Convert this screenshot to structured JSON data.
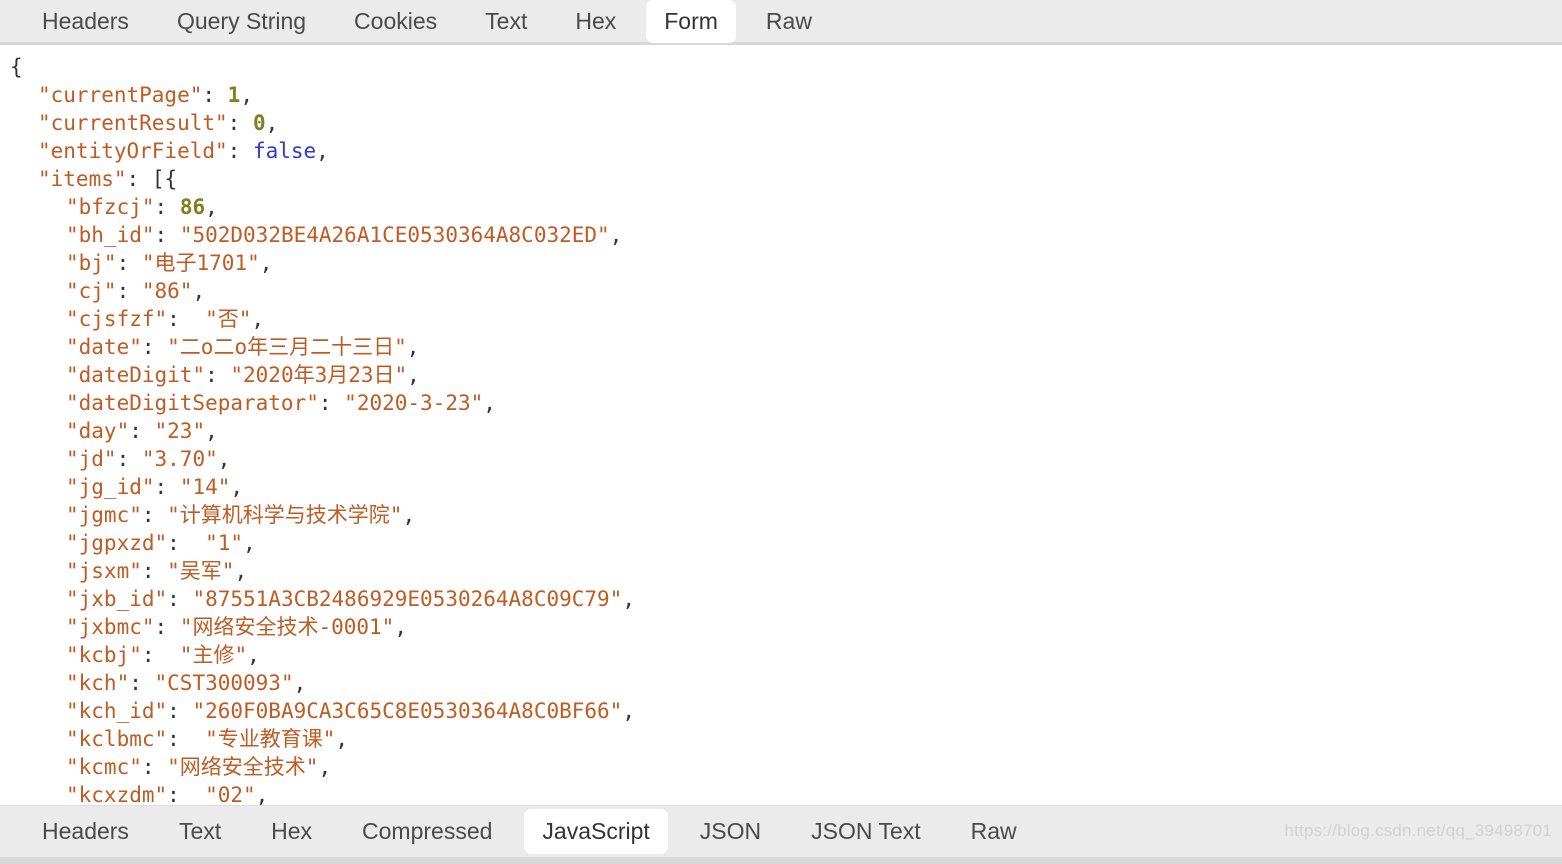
{
  "top_tabs": [
    {
      "label": "Headers",
      "active": false
    },
    {
      "label": "Query String",
      "active": false
    },
    {
      "label": "Cookies",
      "active": false
    },
    {
      "label": "Text",
      "active": false
    },
    {
      "label": "Hex",
      "active": false
    },
    {
      "label": "Form",
      "active": true
    },
    {
      "label": "Raw",
      "active": false
    }
  ],
  "bottom_tabs": [
    {
      "label": "Headers",
      "active": false
    },
    {
      "label": "Text",
      "active": false
    },
    {
      "label": "Hex",
      "active": false
    },
    {
      "label": "Compressed",
      "active": false
    },
    {
      "label": "JavaScript",
      "active": true
    },
    {
      "label": "JSON",
      "active": false
    },
    {
      "label": "JSON Text",
      "active": false
    },
    {
      "label": "Raw",
      "active": false
    }
  ],
  "watermark": "https://blog.csdn.net/qq_39498701",
  "colors": {
    "string": "#bf5b23",
    "key": "#bf5b23",
    "number": "#7f8021",
    "boolean": "#3535d8",
    "punctuation": "#333333",
    "tabbar_bg": "#ebebeb",
    "active_tab_bg": "#ffffff",
    "body_bg": "#ffffff"
  },
  "json_body": {
    "open_brace": "{",
    "lines": [
      {
        "indent": 2,
        "key": "currentPage",
        "value": "1",
        "type": "number",
        "comma": true
      },
      {
        "indent": 2,
        "key": "currentResult",
        "value": "0",
        "type": "number",
        "comma": true
      },
      {
        "indent": 2,
        "key": "entityOrField",
        "value": "false",
        "type": "boolean",
        "comma": true
      },
      {
        "indent": 2,
        "key": "items",
        "value": "[{",
        "type": "raw",
        "comma": false
      },
      {
        "indent": 3,
        "key": "bfzcj",
        "value": "86",
        "type": "number",
        "comma": true
      },
      {
        "indent": 3,
        "key": "bh_id",
        "value": "502D032BE4A26A1CE0530364A8C032ED",
        "type": "string",
        "comma": true
      },
      {
        "indent": 3,
        "key": "bj",
        "value": "电子1701",
        "type": "string",
        "comma": true
      },
      {
        "indent": 3,
        "key": "cj",
        "value": "86",
        "type": "string",
        "comma": true
      },
      {
        "indent": 3,
        "key": "cjsfzf",
        "value": "否",
        "type": "string",
        "comma": true,
        "space_after_colon": true
      },
      {
        "indent": 3,
        "key": "date",
        "value": "二o二o年三月二十三日",
        "type": "string",
        "comma": true
      },
      {
        "indent": 3,
        "key": "dateDigit",
        "value": "2020年3月23日",
        "type": "string",
        "comma": true
      },
      {
        "indent": 3,
        "key": "dateDigitSeparator",
        "value": "2020-3-23",
        "type": "string",
        "comma": true
      },
      {
        "indent": 3,
        "key": "day",
        "value": "23",
        "type": "string",
        "comma": true
      },
      {
        "indent": 3,
        "key": "jd",
        "value": "3.70",
        "type": "string",
        "comma": true
      },
      {
        "indent": 3,
        "key": "jg_id",
        "value": "14",
        "type": "string",
        "comma": true
      },
      {
        "indent": 3,
        "key": "jgmc",
        "value": "计算机科学与技术学院",
        "type": "string",
        "comma": true
      },
      {
        "indent": 3,
        "key": "jgpxzd",
        "value": "1",
        "type": "string",
        "comma": true,
        "space_after_colon": true
      },
      {
        "indent": 3,
        "key": "jsxm",
        "value": "吴军",
        "type": "string",
        "comma": true
      },
      {
        "indent": 3,
        "key": "jxb_id",
        "value": "87551A3CB2486929E0530264A8C09C79",
        "type": "string",
        "comma": true
      },
      {
        "indent": 3,
        "key": "jxbmc",
        "value": "网络安全技术-0001",
        "type": "string",
        "comma": true
      },
      {
        "indent": 3,
        "key": "kcbj",
        "value": "主修",
        "type": "string",
        "comma": true,
        "space_after_colon": true
      },
      {
        "indent": 3,
        "key": "kch",
        "value": "CST300093",
        "type": "string",
        "comma": true
      },
      {
        "indent": 3,
        "key": "kch_id",
        "value": "260F0BA9CA3C65C8E0530364A8C0BF66",
        "type": "string",
        "comma": true
      },
      {
        "indent": 3,
        "key": "kclbmc",
        "value": "专业教育课",
        "type": "string",
        "comma": true,
        "space_after_colon": true
      },
      {
        "indent": 3,
        "key": "kcmc",
        "value": "网络安全技术",
        "type": "string",
        "comma": true
      },
      {
        "indent": 3,
        "key": "kcxzdm",
        "value": "02",
        "type": "string",
        "comma": true,
        "space_after_colon": true
      }
    ]
  }
}
